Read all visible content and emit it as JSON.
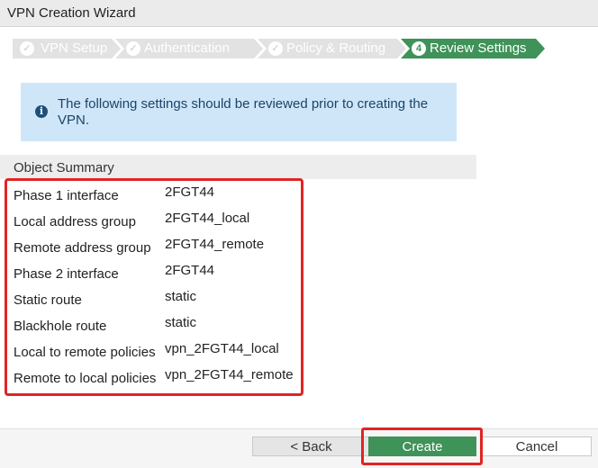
{
  "window": {
    "title": "VPN Creation Wizard"
  },
  "steps": [
    {
      "label": "VPN Setup",
      "icon": "check-icon",
      "state": "done"
    },
    {
      "label": "Authentication",
      "icon": "check-icon",
      "state": "done"
    },
    {
      "label": "Policy & Routing",
      "icon": "check-icon",
      "state": "done"
    },
    {
      "label": "Review Settings",
      "number": "4",
      "state": "active"
    }
  ],
  "info": {
    "text": "The following settings should be reviewed prior to creating the VPN."
  },
  "summary": {
    "header": "Object Summary",
    "rows": [
      {
        "label": "Phase 1 interface",
        "value": "2FGT44"
      },
      {
        "label": "Local address group",
        "value": "2FGT44_local"
      },
      {
        "label": "Remote address group",
        "value": "2FGT44_remote"
      },
      {
        "label": "Phase 2 interface",
        "value": "2FGT44"
      },
      {
        "label": "Static route",
        "value": "static"
      },
      {
        "label": "Blackhole route",
        "value": "static"
      },
      {
        "label": "Local to remote policies",
        "value": "vpn_2FGT44_local"
      },
      {
        "label": "Remote to local policies",
        "value": "vpn_2FGT44_remote"
      }
    ]
  },
  "buttons": {
    "back": "< Back",
    "create": "Create",
    "cancel": "Cancel"
  },
  "colors": {
    "active_step": "#3f9258",
    "highlight": "#e02424",
    "info_bg": "#cfe6f9"
  }
}
